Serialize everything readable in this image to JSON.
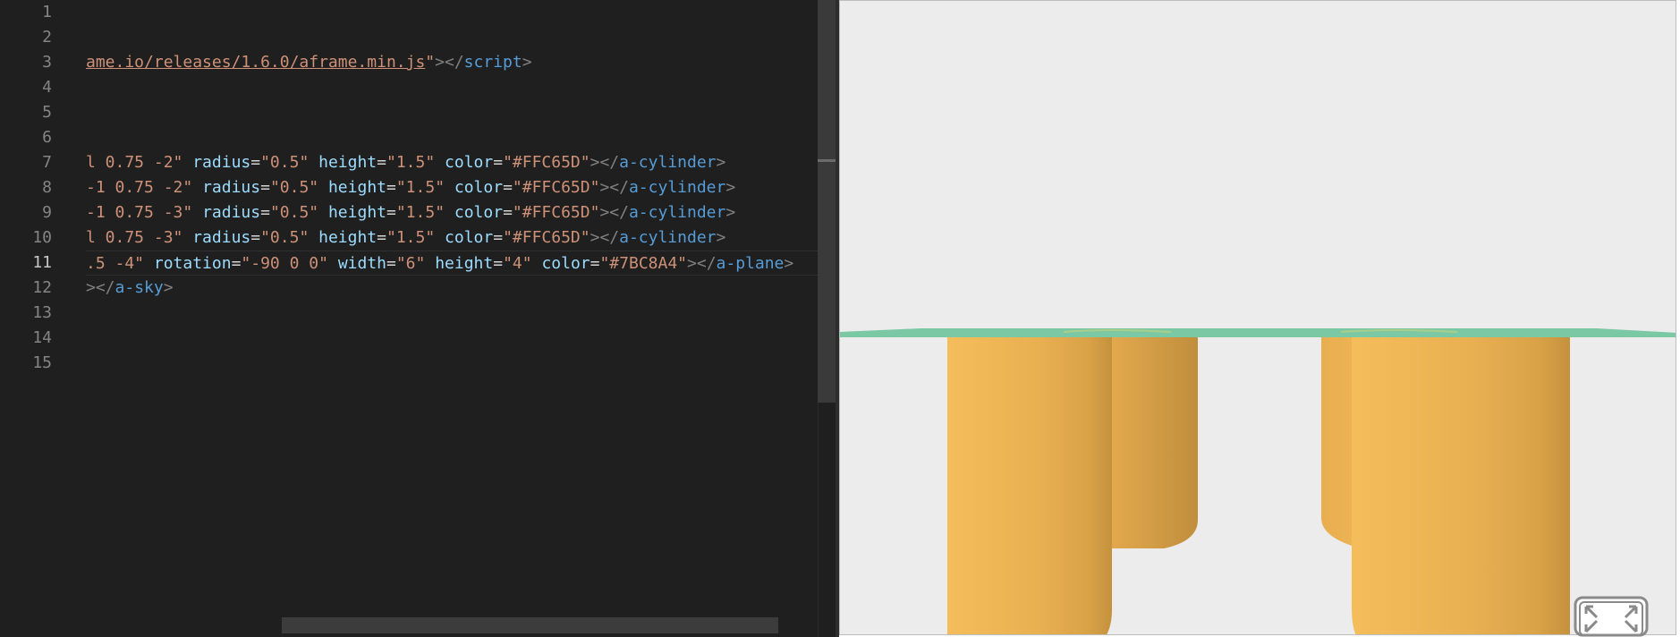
{
  "editor": {
    "line_numbers": [
      "1",
      "2",
      "3",
      "4",
      "5",
      "6",
      "7",
      "8",
      "9",
      "10",
      "11",
      "12",
      "13",
      "14",
      "15"
    ],
    "active_line": "11",
    "lines": {
      "l3": {
        "url": "ame.io/releases/1.6.0/aframe.min.js",
        "q": "\"",
        "close": "></",
        "tag": "script",
        "end": ">"
      },
      "l7": {
        "pos": "l 0.75 -2\"",
        "radius_attr": "radius",
        "radius_val": "\"0.5\"",
        "height_attr": "height",
        "height_val": "\"1.5\"",
        "color_attr": "color",
        "color_val": "\"#FFC65D\"",
        "close": "></",
        "tag": "a-cylinder",
        "end": ">"
      },
      "l8": {
        "pos": "-1 0.75 -2\"",
        "radius_attr": "radius",
        "radius_val": "\"0.5\"",
        "height_attr": "height",
        "height_val": "\"1.5\"",
        "color_attr": "color",
        "color_val": "\"#FFC65D\"",
        "close": "></",
        "tag": "a-cylinder",
        "end": ">"
      },
      "l9": {
        "pos": "-1 0.75 -3\"",
        "radius_attr": "radius",
        "radius_val": "\"0.5\"",
        "height_attr": "height",
        "height_val": "\"1.5\"",
        "color_attr": "color",
        "color_val": "\"#FFC65D\"",
        "close": "></",
        "tag": "a-cylinder",
        "end": ">"
      },
      "l10": {
        "pos": "l 0.75 -3\"",
        "radius_attr": "radius",
        "radius_val": "\"0.5\"",
        "height_attr": "height",
        "height_val": "\"1.5\"",
        "color_attr": "color",
        "color_val": "\"#FFC65D\"",
        "close": "></",
        "tag": "a-cylinder",
        "end": ">"
      },
      "l11": {
        "pos": ".5 -4\"",
        "rot_attr": "rotation",
        "rot_val": "\"-90 0 0\"",
        "width_attr": "width",
        "width_val": "\"6\"",
        "height_attr": "height",
        "height_val": "\"4\"",
        "color_attr": "color",
        "color_val": "\"#7BC8A4\"",
        "close": "></",
        "tag": "a-plane",
        "end": ">"
      },
      "l12": {
        "lead": ">",
        "close": "</",
        "tag": "a-sky",
        "end": ">"
      }
    }
  },
  "preview": {
    "sky_color": "#ECECEC",
    "plane_color": "#7BC8A4",
    "cylinder_color": "#FFC65D",
    "fullscreen_icon": "enter-vr-fullscreen-icon"
  }
}
